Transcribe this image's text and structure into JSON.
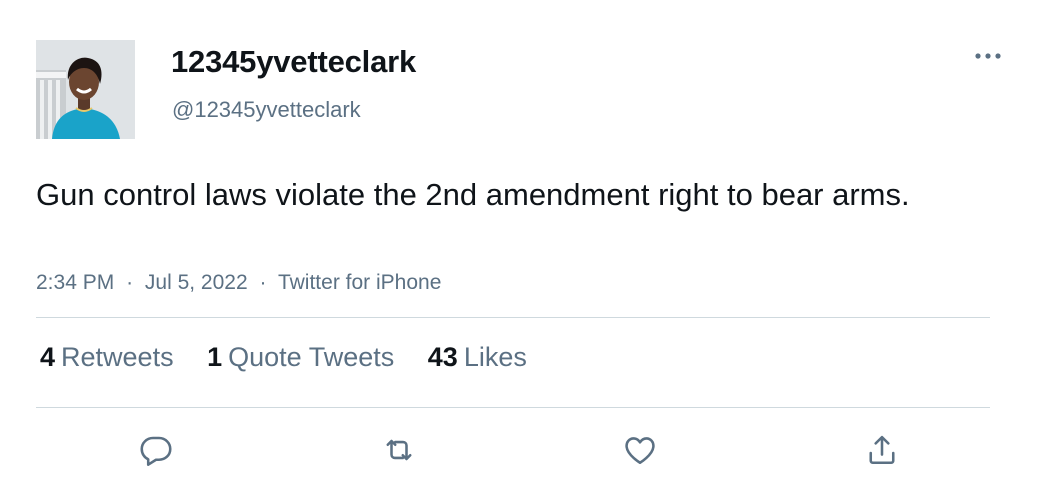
{
  "tweet": {
    "display_name": "12345yvetteclark",
    "handle": "@12345yvetteclark",
    "text": "Gun control laws violate the 2nd amendment right to bear arms.",
    "time": "2:34 PM",
    "separator": "·",
    "date": "Jul 5, 2022",
    "source": "Twitter for iPhone"
  },
  "stats": {
    "retweets_count": "4",
    "retweets_label": "Retweets",
    "quotes_count": "1",
    "quotes_label": "Quote Tweets",
    "likes_count": "43",
    "likes_label": "Likes"
  },
  "icons": {
    "more": "more-horizontal-icon",
    "reply": "reply-icon",
    "retweet": "retweet-icon",
    "like": "heart-icon",
    "share": "share-icon"
  },
  "colors": {
    "text_primary": "#0f1419",
    "text_secondary": "#5b7083",
    "divider": "#cfd9de",
    "avatar_jacket": "#1aa3c9"
  }
}
